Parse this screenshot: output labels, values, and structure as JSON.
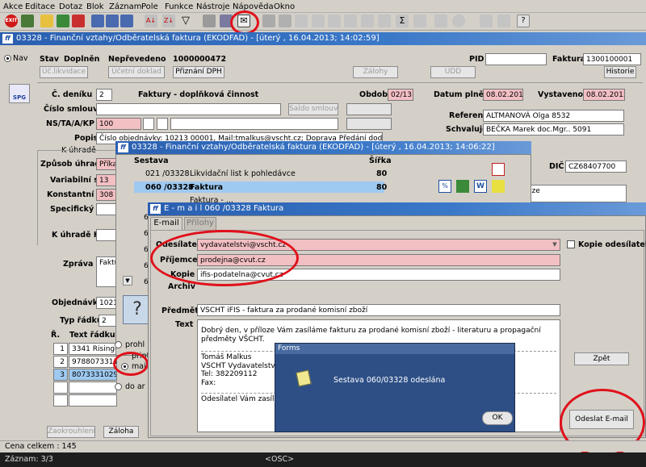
{
  "menu": [
    "Akce",
    "Editace",
    "Dotaz",
    "Blok",
    "Záznam",
    "Pole",
    "Funkce",
    "Nástroje",
    "Nápověda",
    "Okno"
  ],
  "main_window": {
    "title": "03328 - Finanční vztahy/Odběratelská faktura (EKODFAD) - [úterý , 16.04.2013; 14:02:59]",
    "nav_label": "Nav",
    "stav_label": "Stav",
    "stav_value": "Doplněn",
    "neprevedeno": "Nepřevedeno",
    "doc_no": "1000000472",
    "pid_label": "PID",
    "faktura_label": "Faktura",
    "faktura_value": "1300100001",
    "buttons": [
      "Úč.likvidace",
      "Účetní doklad",
      "Přiznání DPH",
      "Zálohy",
      "UDD",
      "Historie"
    ],
    "cdeniku_label": "Č. deníku",
    "cdeniku_value": "2",
    "denik_name": "Faktury - doplňková činnost",
    "obdobi_label": "Období",
    "obdobi_value": "02/13",
    "datum_plneni_label": "Datum plnění",
    "datum_plneni_value": "08.02.2013",
    "vystaveno_label": "Vystaveno",
    "vystaveno_value": "08.02.2013",
    "cislo_smlouvy_label": "Číslo smlouvy",
    "saldo_smlouvy": "Saldo smlouvy",
    "referent_label": "Referent",
    "referent_value": "ALTMANOVÁ Olga 8532",
    "ns_label": "NS/TA/A/KP",
    "ns_value": "100",
    "schvaluje_label": "Schvaluje",
    "schvaluje_value": "BEČKA Marek doc.Mgr.. 5091",
    "popis_label": "Popis",
    "popis_value": "Číslo objednávky: 10213 00001, Mail:tmalkus@vscht.cz; Doprava Předání dodavatelem",
    "k_uhrade_group": "K úhradě",
    "zpusob_label": "Způsob úhrady",
    "zpusob_value": "Příkaz",
    "variabilni_label": "Variabilní s.",
    "variabilni_value": "13",
    "konstantni_label": "Konstantní s.",
    "konstantni_value": "308",
    "specificky_label": "Specifický s.",
    "k_uhrade_kc_label": "K úhradě Kč",
    "dic_label": "DIČ",
    "dic_value": "CZ68407700",
    "right_text": "aze",
    "zprava_label": "Zpráva",
    "zprava_value": "Faktur",
    "objednavka_label": "Objednávka",
    "objednavka_value": "10213",
    "typ_radku_label": "Typ řádků",
    "typ_radku_value": "2",
    "r_header": "Ř.",
    "text_radku_header": "Text řádku",
    "rows": [
      {
        "n": "1",
        "text": "3341 Risinger"
      },
      {
        "n": "2",
        "text": "97880733110"
      },
      {
        "n": "3",
        "text": "80733310295 R"
      }
    ],
    "zaokrouhleni": "Zaokrouhlení",
    "zaloha": "Záloha",
    "cena_celkem": "Cena celkem : 145",
    "spg": "SPG"
  },
  "sestava_window": {
    "title": "03328 - Finanční vztahy/Odběratelská faktura (EKODFAD) - [úterý , 16.04.2013; 14:06:22]",
    "col_sestava": "Sestava",
    "col_sirka": "Šířka",
    "rows": [
      {
        "code": "021 /03328",
        "name": "Likvidační list k pohledávce",
        "width": "80"
      },
      {
        "code": "060 /03328",
        "name": "Faktura",
        "width": "80"
      },
      {
        "code": "",
        "name": "Faktura - ...",
        "width": ""
      }
    ],
    "row_digits": [
      "6",
      "6",
      "6",
      "6",
      "6"
    ],
    "radio_options": [
      "prohl",
      "print",
      "mail",
      "do ar"
    ],
    "selected_option": "mail"
  },
  "email_window": {
    "title": "E - m a i l   060 /03328 Faktura",
    "tabs": [
      "E-mail",
      "Přílohy"
    ],
    "odesilatel_label": "Odesílatel",
    "odesilatel_value": "vydavatelstvi@vscht.cz",
    "kopie_odesilateli": "Kopie odesílateli",
    "prijemce_label": "Příjemce",
    "prijemce_value": "prodejna@cvut.cz",
    "kopie_label": "Kopie",
    "kopie_value": "ifis-podatelna@cvut.cz",
    "archiv_label": "Archiv",
    "predmet_label": "Předmět",
    "predmet_value": "VSCHT iFIS - faktura za prodané komisní zboží",
    "text_label": "Text",
    "body_lines": [
      "Dobrý den, v příloze Vám zasíláme fakturu za prodané komisní zboží - literaturu a propagační předměty VŠCHT.",
      "",
      "Tomáš Malkus",
      "VSCHT Vydavatelstvi",
      "Tel: 382209112",
      "Fax:",
      "",
      "Odesílatel Vám zasílá tisk"
    ],
    "zpet": "Zpět",
    "odeslat": "Odeslat E-mail"
  },
  "forms_dialog": {
    "title": "Forms",
    "message": "Sestava 060/03328 odeslána",
    "ok": "OK"
  },
  "status": {
    "record": "Záznam: 3/3",
    "osc": "<OSC>"
  },
  "colors": {
    "pink_field": "#f2bfc3",
    "title_blue": "#2a5fb0",
    "dialog_blue": "#2d4f86",
    "highlight_red": "#e0101a",
    "selected_row": "#9ec9f0"
  }
}
